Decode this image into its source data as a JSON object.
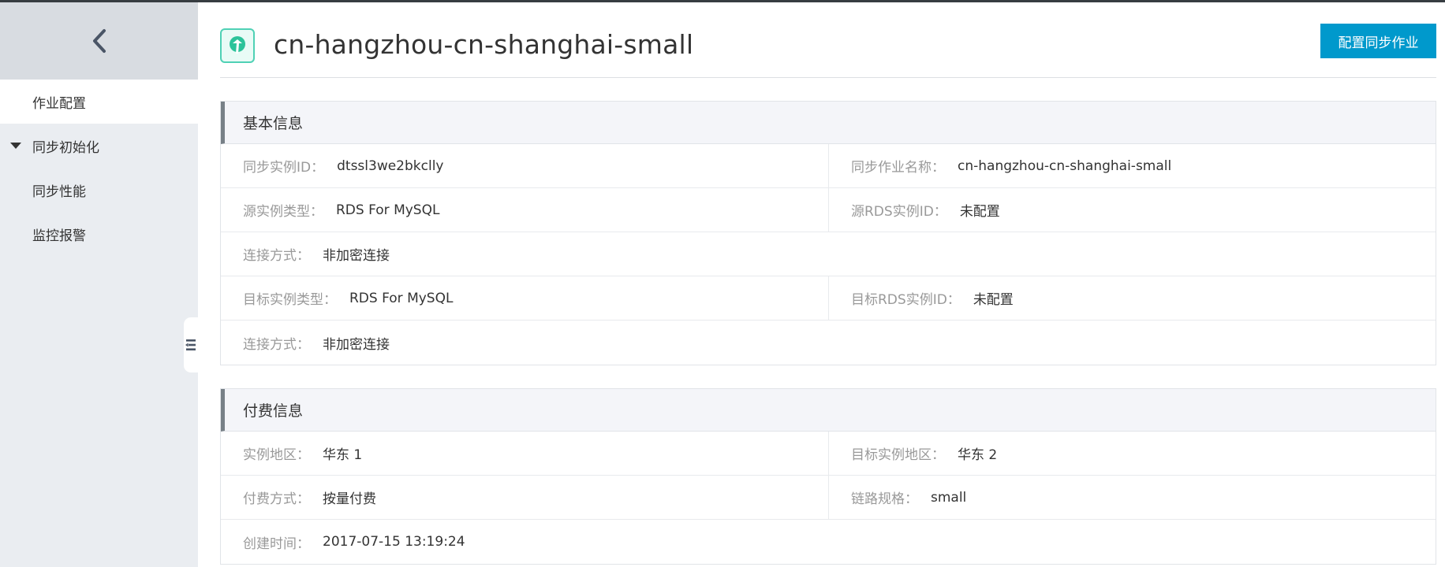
{
  "sidebar": {
    "items": [
      {
        "label": "作业配置"
      },
      {
        "label": "同步初始化"
      },
      {
        "label": "同步性能"
      },
      {
        "label": "监控报警"
      }
    ]
  },
  "header": {
    "title": "cn-hangzhou-cn-shanghai-small",
    "config_button": "配置同步作业"
  },
  "basic_info": {
    "title": "基本信息",
    "instance_id_label": "同步实例ID：",
    "instance_id_value": "dtssl3we2bkclly",
    "job_name_label": "同步作业名称：",
    "job_name_value": "cn-hangzhou-cn-shanghai-small",
    "src_type_label": "源实例类型：",
    "src_type_value": "RDS For MySQL",
    "src_rds_label": "源RDS实例ID：",
    "src_rds_value": "未配置",
    "src_conn_label": "连接方式：",
    "src_conn_value": "非加密连接",
    "dst_type_label": "目标实例类型：",
    "dst_type_value": "RDS For MySQL",
    "dst_rds_label": "目标RDS实例ID：",
    "dst_rds_value": "未配置",
    "dst_conn_label": "连接方式：",
    "dst_conn_value": "非加密连接"
  },
  "billing_info": {
    "title": "付费信息",
    "region_label": "实例地区：",
    "region_value": "华东 1",
    "dst_region_label": "目标实例地区：",
    "dst_region_value": "华东 2",
    "pay_label": "付费方式：",
    "pay_value": "按量付费",
    "spec_label": "链路规格：",
    "spec_value": "small",
    "created_label": "创建时间：",
    "created_value": "2017-07-15 13:19:24"
  }
}
